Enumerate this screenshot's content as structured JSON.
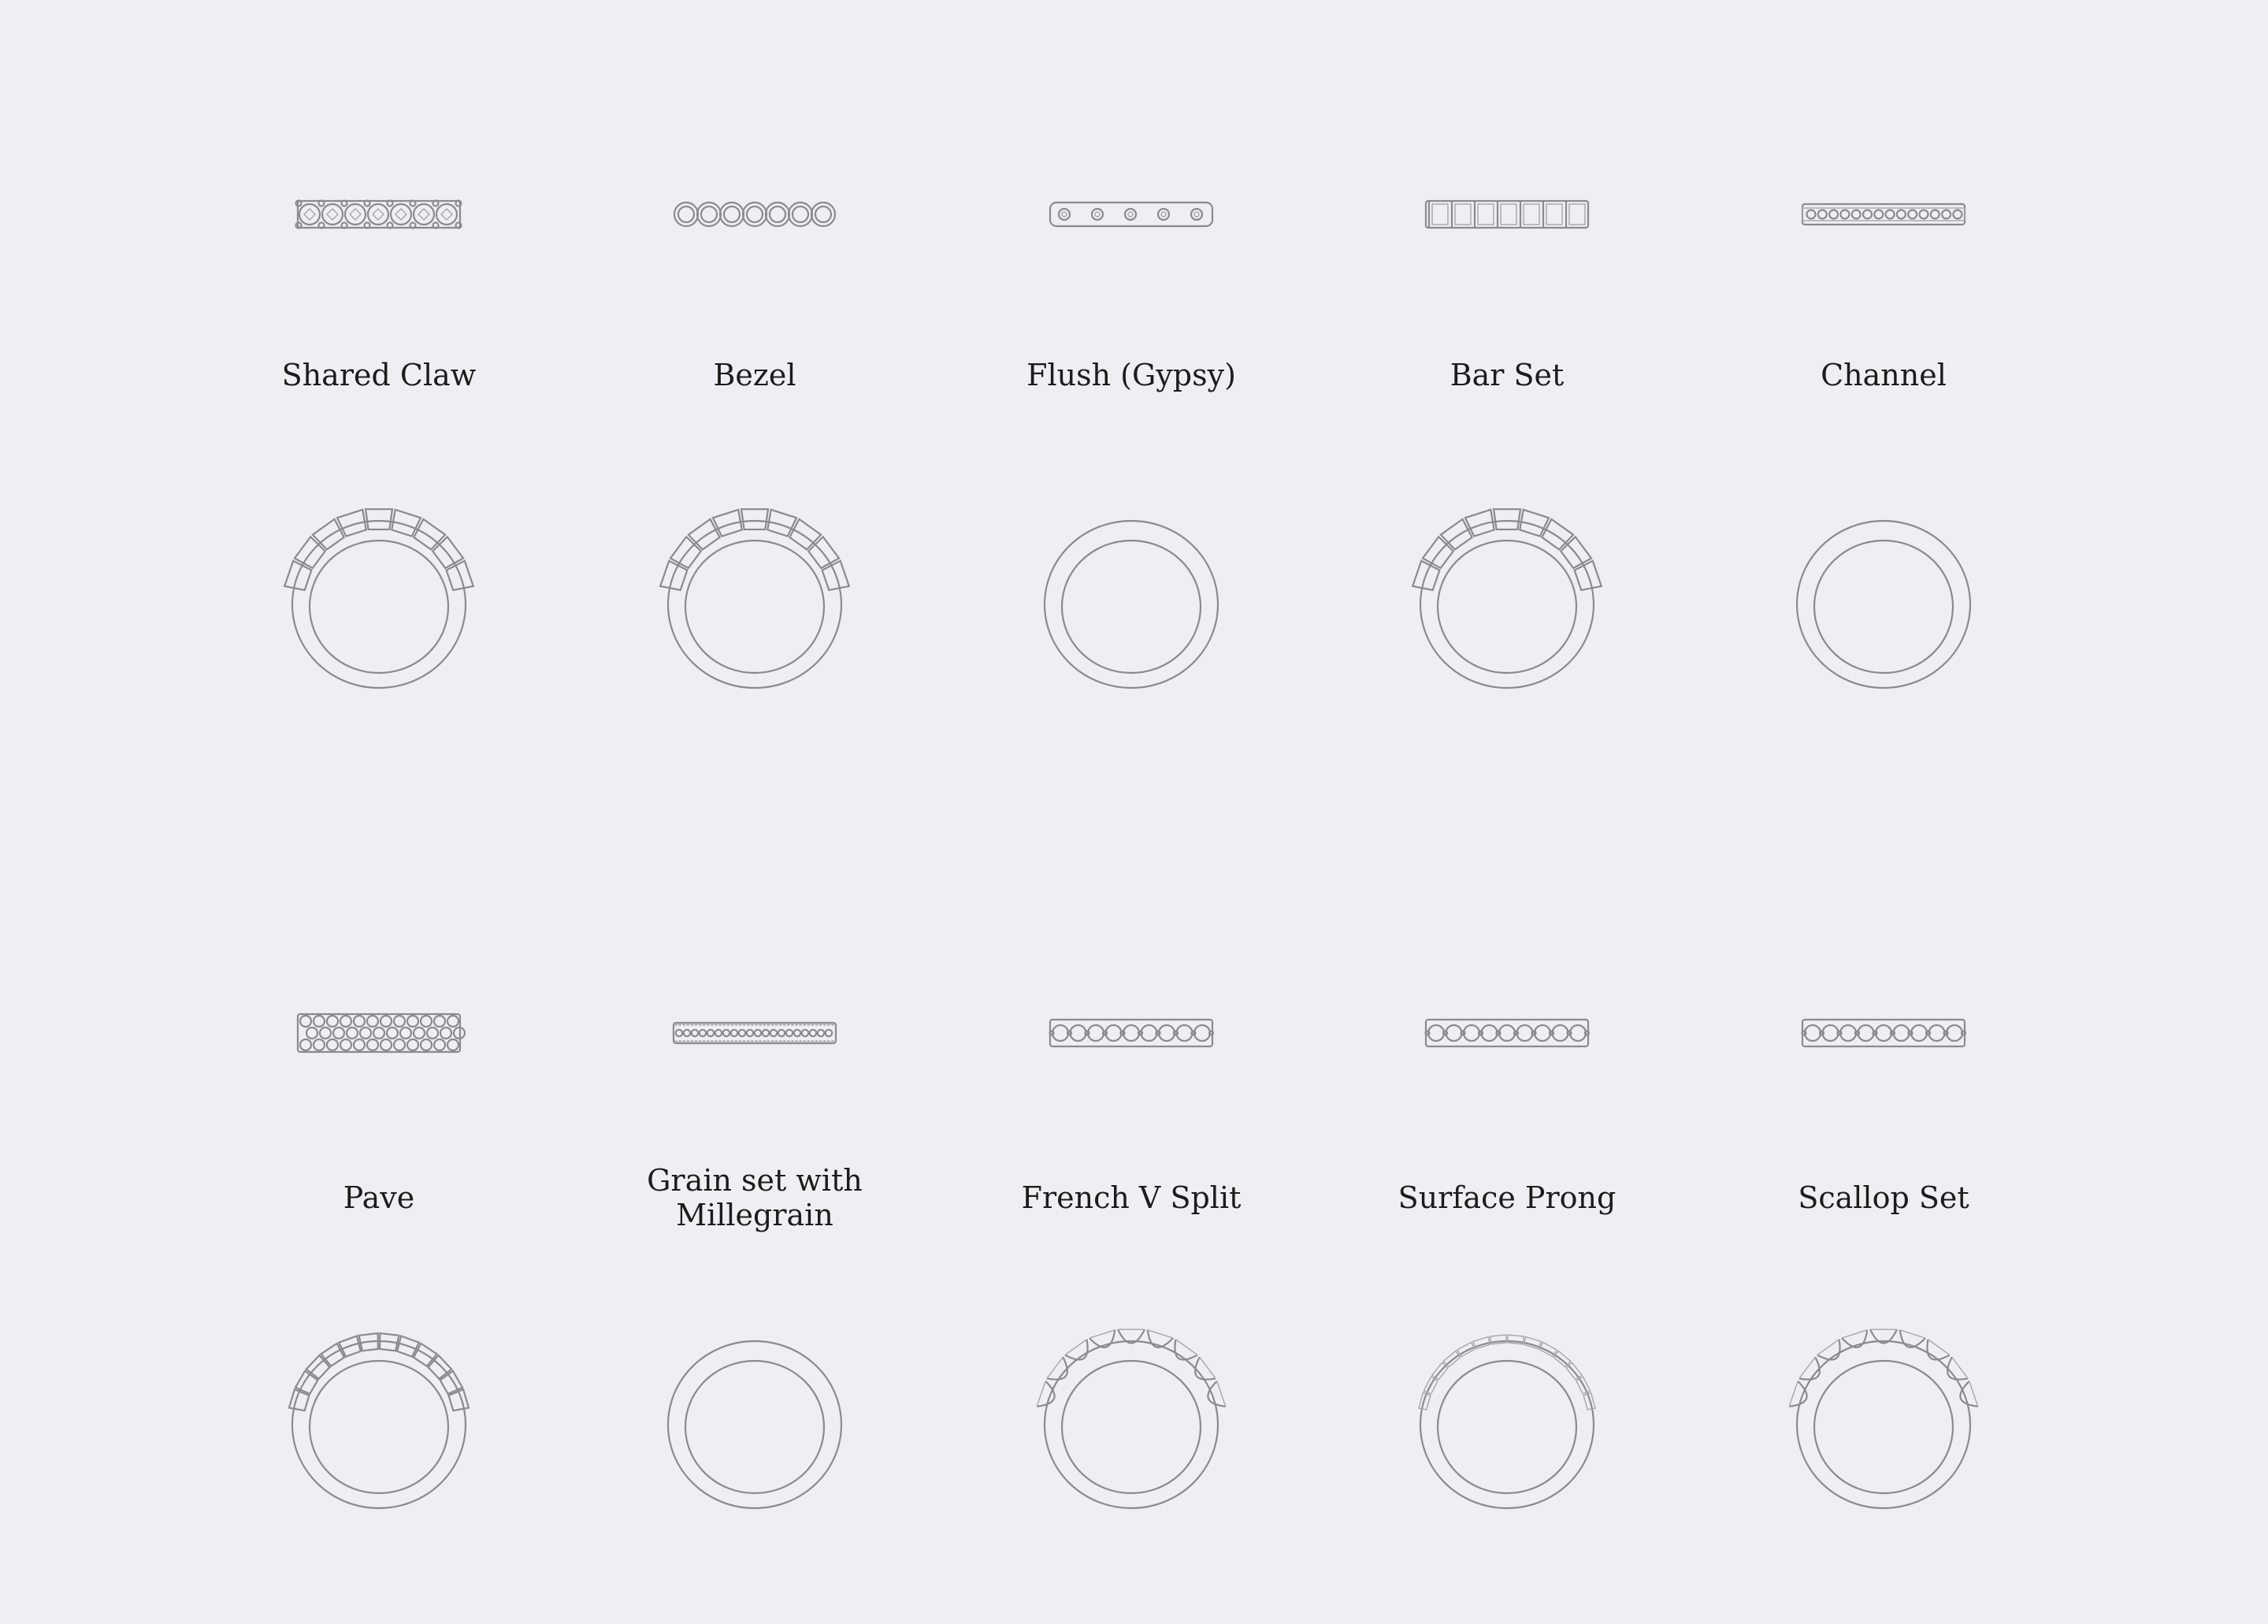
{
  "sheet": {
    "background_color": "#efeff3",
    "pencil_color": "#8b8b8f",
    "items": [
      {
        "label_lines": [
          "Shared Claw"
        ],
        "setting": "shared-claw"
      },
      {
        "label_lines": [
          "Bezel"
        ],
        "setting": "bezel"
      },
      {
        "label_lines": [
          "Flush (Gypsy)"
        ],
        "setting": "flush"
      },
      {
        "label_lines": [
          "Bar Set"
        ],
        "setting": "bar"
      },
      {
        "label_lines": [
          "Channel"
        ],
        "setting": "channel"
      },
      {
        "label_lines": [
          "Pave"
        ],
        "setting": "pave"
      },
      {
        "label_lines": [
          "Grain set with",
          "Millegrain"
        ],
        "setting": "grain"
      },
      {
        "label_lines": [
          "French V Split"
        ],
        "setting": "french-v"
      },
      {
        "label_lines": [
          "Surface Prong"
        ],
        "setting": "surface-prong"
      },
      {
        "label_lines": [
          "Scallop Set"
        ],
        "setting": "scallop"
      }
    ]
  }
}
